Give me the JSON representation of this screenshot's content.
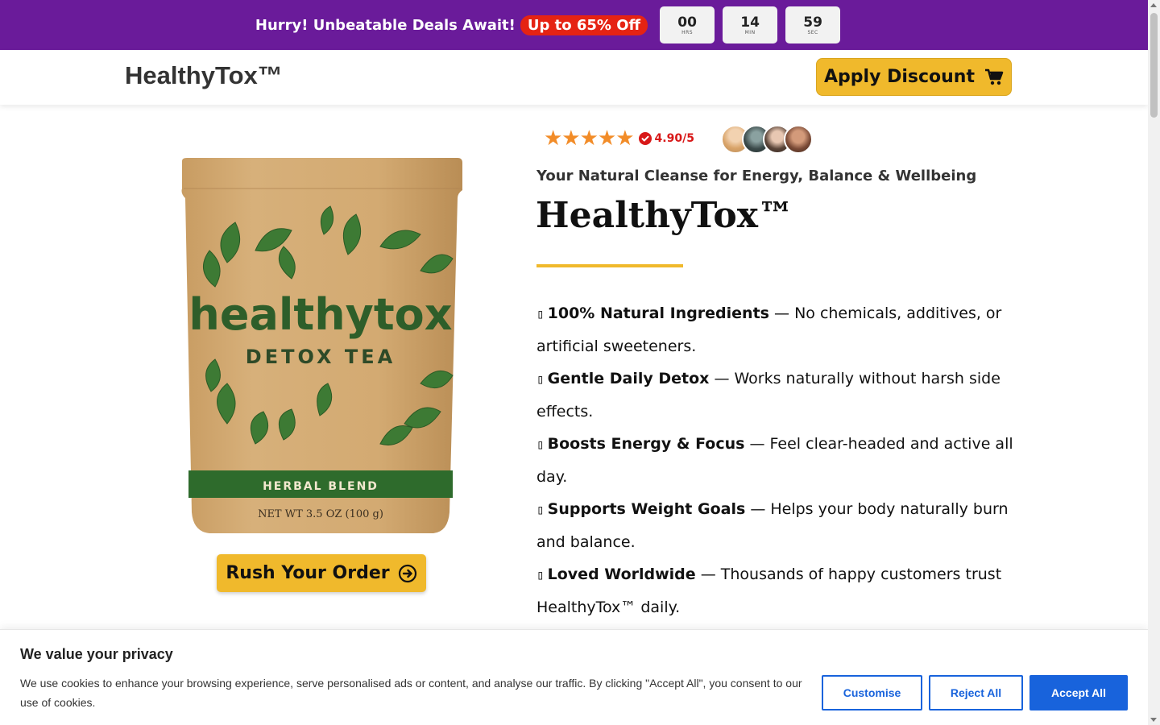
{
  "promo": {
    "text": "Hurry! Unbeatable Deals Await!",
    "badge": "Up to 65% Off",
    "timer": [
      {
        "value": "00",
        "unit": "HRS"
      },
      {
        "value": "14",
        "unit": "MIN"
      },
      {
        "value": "59",
        "unit": "SEC"
      }
    ]
  },
  "header": {
    "logo": "HealthyTox™",
    "apply_button": "Apply Discount"
  },
  "product": {
    "pouch_brand": "healthytox",
    "pouch_subtitle": "DETOX TEA",
    "pouch_band": "HERBAL BLEND",
    "pouch_weight": "NET WT 3.5 OZ (100 g)",
    "rush_button": "Rush Your Order"
  },
  "hero": {
    "stars": "★★★★★",
    "score": "4.90/5",
    "tagline": "Your Natural Cleanse for Energy, Balance & Wellbeing",
    "title": "HealthyTox™",
    "benefits": [
      {
        "bullet": "▯",
        "title": "100% Natural Ingredients",
        "text": " — No chemicals, additives, or artificial sweeteners."
      },
      {
        "bullet": "▯",
        "title": "Gentle Daily Detox",
        "text": " — Works naturally without harsh side effects."
      },
      {
        "bullet": "▯",
        "title": "Boosts Energy & Focus",
        "text": " — Feel clear-headed and active all day."
      },
      {
        "bullet": "▯",
        "title": "Supports Weight Goals",
        "text": " — Helps your body naturally burn and balance."
      },
      {
        "bullet": "▯",
        "title": "Loved Worldwide",
        "text": " — Thousands of happy customers trust HealthyTox™ daily."
      }
    ]
  },
  "cookie": {
    "title": "We value your privacy",
    "text": "We use cookies to enhance your browsing experience, serve personalised ads or content, and analyse our traffic. By clicking \"Accept All\", you consent to our use of cookies.",
    "customise": "Customise",
    "reject": "Reject All",
    "accept": "Accept All"
  },
  "colors": {
    "promo_bg": "#6a1b9a",
    "badge_red": "#e52313",
    "accent_yellow": "#f0b92c",
    "star_orange": "#f28c28",
    "cookie_blue": "#1863dc",
    "pouch_green": "#2e6b2c"
  }
}
